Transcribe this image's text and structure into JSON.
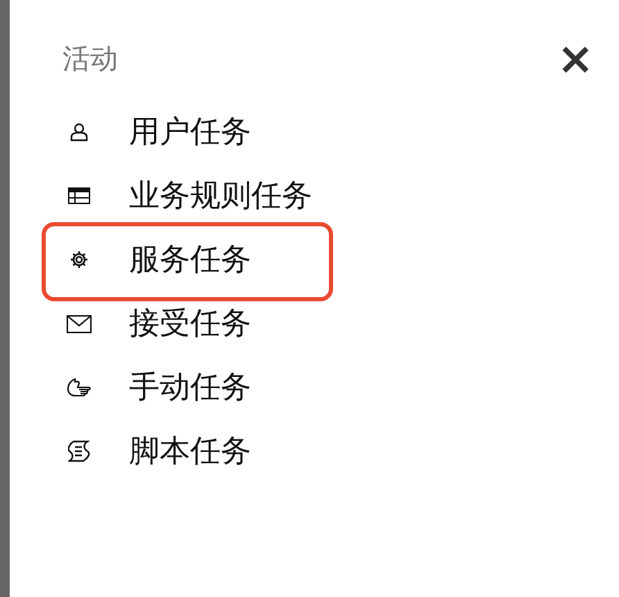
{
  "panel": {
    "title": "活动",
    "close": "×"
  },
  "items": [
    {
      "kind": "user",
      "label": "用户任务",
      "highlighted": false
    },
    {
      "kind": "business-rule",
      "label": "业务规则任务",
      "highlighted": false
    },
    {
      "kind": "service",
      "label": "服务任务",
      "highlighted": true
    },
    {
      "kind": "receive",
      "label": "接受任务",
      "highlighted": false
    },
    {
      "kind": "manual",
      "label": "手动任务",
      "highlighted": false
    },
    {
      "kind": "script",
      "label": "脚本任务",
      "highlighted": false
    }
  ]
}
